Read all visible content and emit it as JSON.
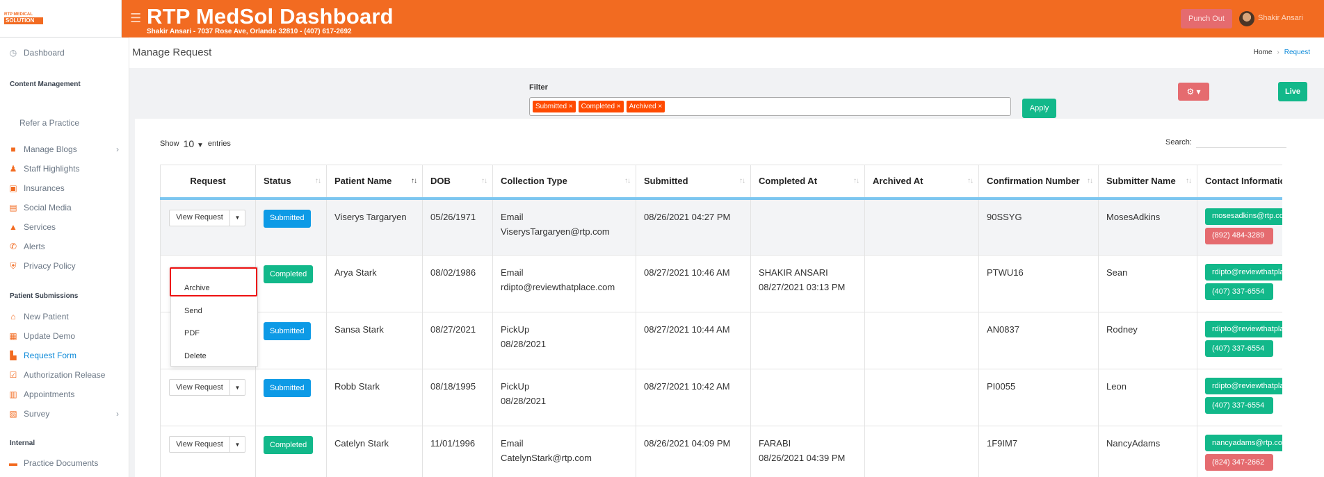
{
  "app": {
    "logo_top": "RTP MEDICAL",
    "logo_bottom": "SOLUTION",
    "title": "RTP MedSol Dashboard",
    "subtitle": "Shakir Ansari - 7037 Rose Ave, Orlando 32810 - (407) 617-2692",
    "punch_out": "Punch Out",
    "user_name": "Shakir Ansari"
  },
  "sidebar": {
    "dashboard": "Dashboard",
    "content_head": "Content Management",
    "refer": "Refer a Practice",
    "items": [
      {
        "label": "Manage Blogs",
        "icon": "blogger-icon"
      },
      {
        "label": "Staff Highlights",
        "icon": "staff-icon"
      },
      {
        "label": "Insurances",
        "icon": "insurance-icon"
      },
      {
        "label": "Social Media",
        "icon": "social-icon"
      },
      {
        "label": "Services",
        "icon": "services-icon"
      },
      {
        "label": "Alerts",
        "icon": "phone-icon"
      },
      {
        "label": "Privacy Policy",
        "icon": "shield-icon"
      }
    ],
    "patient_head": "Patient Submissions",
    "patient_items": [
      {
        "label": "New Patient"
      },
      {
        "label": "Update Demo"
      },
      {
        "label": "Request Form"
      },
      {
        "label": "Authorization Release"
      },
      {
        "label": "Appointments"
      },
      {
        "label": "Survey"
      }
    ],
    "internal_head": "Internal",
    "practice_docs": "Practice Documents"
  },
  "breadcrumb": {
    "page_title": "Manage Request",
    "home": "Home",
    "current": "Request"
  },
  "filter": {
    "label": "Filter",
    "tags": [
      "Submitted ×",
      "Completed ×",
      "Archived ×"
    ],
    "apply": "Apply",
    "live": "Live"
  },
  "table_controls": {
    "show": "Show",
    "entries_value": "10",
    "entries": "entries",
    "search": "Search:"
  },
  "columns": [
    "Request",
    "Status",
    "Patient Name",
    "DOB",
    "Collection Type",
    "Submitted",
    "Completed At",
    "Archived At",
    "Confirmation Number",
    "Submitter Name",
    "Contact Information"
  ],
  "view_request": "View Request",
  "rows": [
    {
      "status": "Submitted",
      "name": "Viserys Targaryen",
      "dob": "05/26/1971",
      "ctype": "Email",
      "cdetail": "ViserysTargaryen@rtp.com",
      "submitted": "08/26/2021 04:27 PM",
      "completed_by": "",
      "completed_at": "",
      "archived": "",
      "conf": "90SSYG",
      "submitter": "MosesAdkins",
      "email": "mosesadkins@rtp.com",
      "phone": "(892) 484-3289"
    },
    {
      "status": "Completed",
      "name": "Arya Stark",
      "dob": "08/02/1986",
      "ctype": "Email",
      "cdetail": "rdipto@reviewthatplace.com",
      "submitted": "08/27/2021 10:46 AM",
      "completed_by": "SHAKIR ANSARI",
      "completed_at": "08/27/2021 03:13 PM",
      "archived": "",
      "conf": "PTWU16",
      "submitter": "Sean",
      "email": "rdipto@reviewthatplace.com",
      "phone": "(407) 337-6554"
    },
    {
      "status": "Submitted",
      "name": "Sansa Stark",
      "dob": "08/27/2021",
      "ctype": "PickUp",
      "cdetail": "08/28/2021",
      "submitted": "08/27/2021 10:44 AM",
      "completed_by": "",
      "completed_at": "",
      "archived": "",
      "conf": "AN0837",
      "submitter": "Rodney",
      "email": "rdipto@reviewthatplace.com",
      "phone": "(407) 337-6554"
    },
    {
      "status": "Submitted",
      "name": "Robb Stark",
      "dob": "08/18/1995",
      "ctype": "PickUp",
      "cdetail": "08/28/2021",
      "submitted": "08/27/2021 10:42 AM",
      "completed_by": "",
      "completed_at": "",
      "archived": "",
      "conf": "PI0055",
      "submitter": "Leon",
      "email": "rdipto@reviewthatplace.com",
      "phone": "(407) 337-6554"
    },
    {
      "status": "Completed",
      "name": "Catelyn Stark",
      "dob": "11/01/1996",
      "ctype": "Email",
      "cdetail": "CatelynStark@rtp.com",
      "submitted": "08/26/2021 04:09 PM",
      "completed_by": "FARABI",
      "completed_at": "08/26/2021 04:39 PM",
      "archived": "",
      "conf": "1F9IM7",
      "submitter": "NancyAdams",
      "email": "nancyadams@rtp.com",
      "phone": "(824) 347-2662"
    }
  ],
  "dropdown": {
    "items": [
      "Archive",
      "Send",
      "PDF",
      "Delete"
    ]
  },
  "colors": {
    "brand": "#f26b21",
    "submitted": "#0d9ae6",
    "completed": "#12b88a",
    "danger": "#e56b6f"
  }
}
